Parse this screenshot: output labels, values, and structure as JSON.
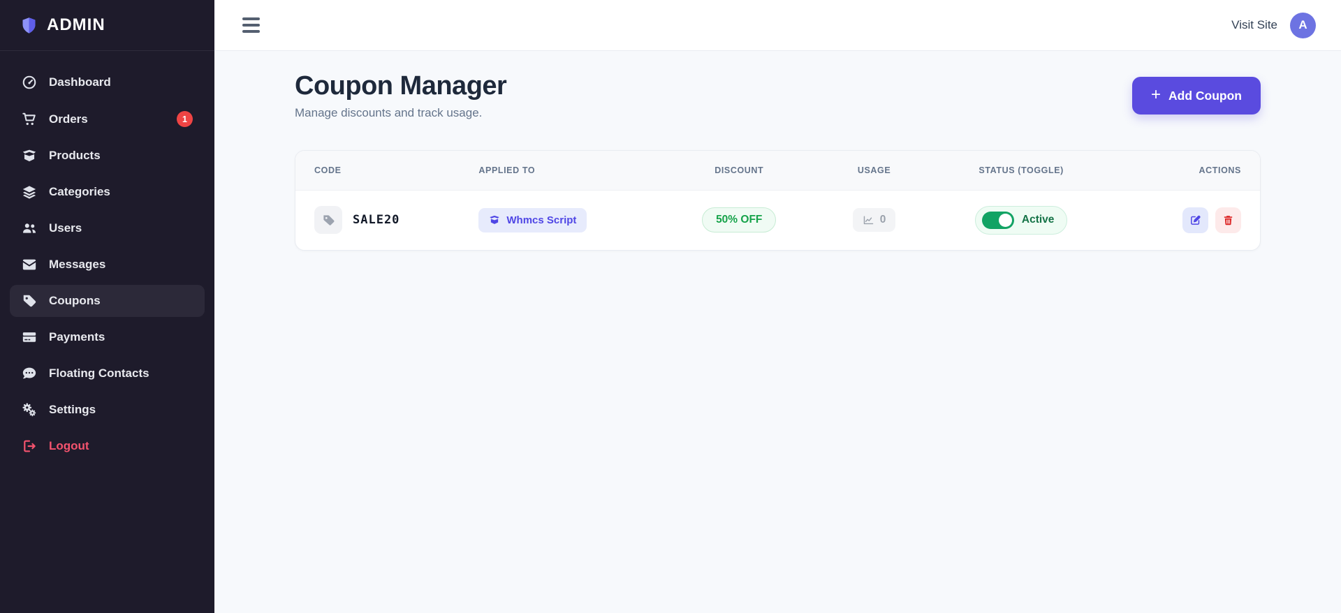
{
  "brand": {
    "name": "ADMIN",
    "logo_icon": "shield-icon"
  },
  "sidebar": {
    "items": [
      {
        "label": "Dashboard",
        "icon": "gauge-icon"
      },
      {
        "label": "Orders",
        "icon": "cart-icon",
        "badge": "1"
      },
      {
        "label": "Products",
        "icon": "box-open-icon"
      },
      {
        "label": "Categories",
        "icon": "layer-group-icon"
      },
      {
        "label": "Users",
        "icon": "users-icon"
      },
      {
        "label": "Messages",
        "icon": "envelope-icon"
      },
      {
        "label": "Coupons",
        "icon": "tag-icon",
        "active": true
      },
      {
        "label": "Payments",
        "icon": "credit-card-icon"
      },
      {
        "label": "Floating Contacts",
        "icon": "comment-dots-icon"
      },
      {
        "label": "Settings",
        "icon": "gears-icon"
      },
      {
        "label": "Logout",
        "icon": "logout-icon",
        "danger": true
      }
    ]
  },
  "topbar": {
    "menu_icon": "hamburger-icon",
    "visit_site_label": "Visit Site",
    "avatar_letter": "A"
  },
  "page": {
    "title": "Coupon Manager",
    "subtitle": "Manage discounts and track usage.",
    "add_button_label": "Add Coupon",
    "add_button_plus": "+"
  },
  "table": {
    "headers": [
      "Code",
      "Applied To",
      "Discount",
      "Usage",
      "Status (Toggle)",
      "Actions"
    ],
    "rows": [
      {
        "code": "SALE20",
        "applied_to": "Whmcs Script",
        "discount": "50% OFF",
        "usage": "0",
        "status": "Active",
        "status_on": true
      }
    ]
  },
  "colors": {
    "sidebar_bg": "#1e1b2b",
    "sidebar_active_bg": "#2c2939",
    "accent_indigo": "#5a4bdf",
    "logout_red": "#f4536e",
    "badge_red": "#ef4444",
    "success_green": "#12a364",
    "discount_text_green": "#16a34a",
    "delete_red": "#dc2626",
    "avatar_bg": "#6d73e2"
  }
}
